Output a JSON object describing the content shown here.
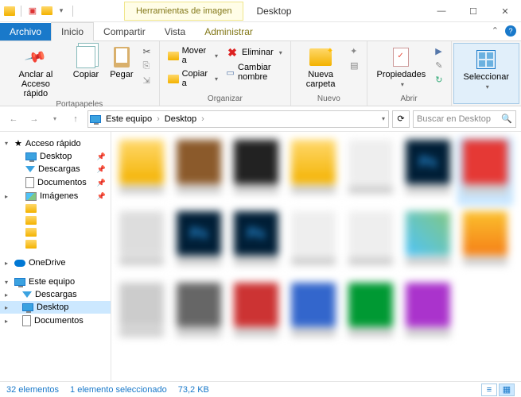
{
  "titlebar": {
    "tools_label": "Herramientas de imagen",
    "title": "Desktop"
  },
  "tabs": {
    "file": "Archivo",
    "home": "Inicio",
    "share": "Compartir",
    "view": "Vista",
    "manage": "Administrar"
  },
  "ribbon": {
    "clipboard": {
      "pin": "Anclar al Acceso rápido",
      "copy": "Copiar",
      "paste": "Pegar",
      "label": "Portapapeles"
    },
    "organize": {
      "move": "Mover a",
      "copy_to": "Copiar a",
      "delete": "Eliminar",
      "rename": "Cambiar nombre",
      "label": "Organizar"
    },
    "new": {
      "newfolder": "Nueva carpeta",
      "label": "Nuevo"
    },
    "open": {
      "properties": "Propiedades",
      "label": "Abrir"
    },
    "select": {
      "select": "Seleccionar",
      "label": ""
    }
  },
  "address": {
    "crumb1": "Este equipo",
    "crumb2": "Desktop"
  },
  "search": {
    "placeholder": "Buscar en Desktop"
  },
  "sidebar": {
    "quick": "Acceso rápido",
    "desktop": "Desktop",
    "downloads": "Descargas",
    "documents": "Documentos",
    "pictures": "Imágenes",
    "onedrive": "OneDrive",
    "thispc": "Este equipo",
    "downloads2": "Descargas",
    "desktop2": "Desktop",
    "documents2": "Documentos"
  },
  "status": {
    "count": "32 elementos",
    "selected": "1 elemento seleccionado",
    "size": "73,2 KB"
  }
}
